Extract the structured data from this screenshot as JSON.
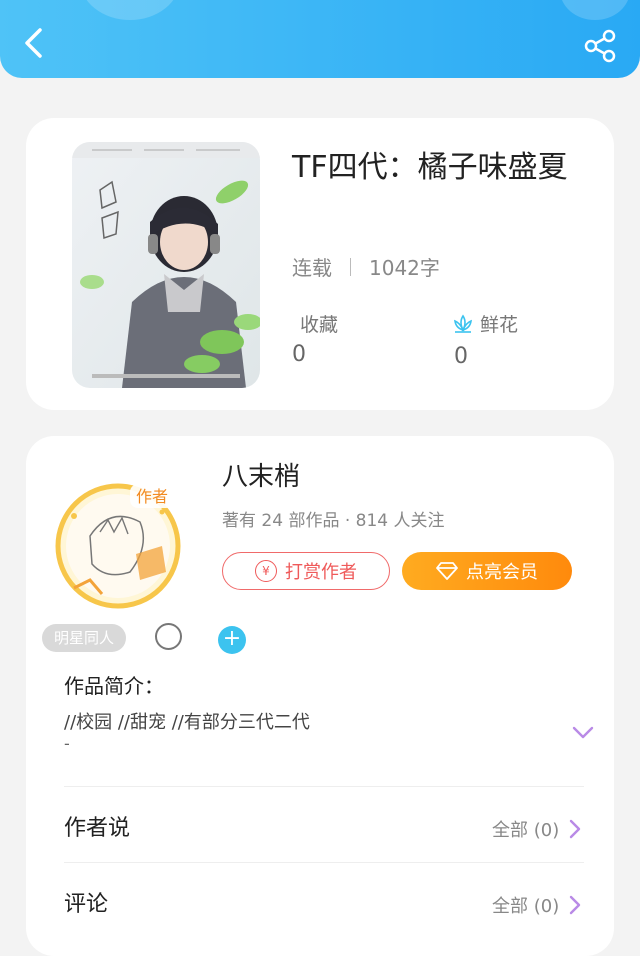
{
  "book": {
    "title": "TF四代：橘子味盛夏",
    "status": "连载",
    "word_count": "1042字",
    "favorites_label": "收藏",
    "favorites_count": "0",
    "flowers_label": "鲜花",
    "flowers_count": "0"
  },
  "author": {
    "name": "八末梢",
    "meta": "著有 24 部作品 · 814 人关注",
    "badge": "作者",
    "tip_button": "打赏作者",
    "vip_button": "点亮会员",
    "tag": "明星同人"
  },
  "intro": {
    "title": "作品简介：",
    "text": "//校园 //甜宠 //有部分三代二代",
    "dash": "-"
  },
  "rows": [
    {
      "label": "作者说",
      "right": "全部 (0)"
    },
    {
      "label": "评论",
      "right": "全部 (0)"
    }
  ],
  "colors": {
    "header": "#29a9f4",
    "tip": "#ef5a5a",
    "vip": "#ff8a0c",
    "plus": "#3cc3ef",
    "chevron": "#b98ae6"
  },
  "icons": {
    "back": "back-arrow-icon",
    "share": "share-icon",
    "flower": "lotus-flower-icon",
    "yen": "yen-icon",
    "diamond": "diamond-icon",
    "plus": "plus-icon",
    "expand": "chevron-down-icon",
    "row_arrow": "chevron-right-icon"
  }
}
